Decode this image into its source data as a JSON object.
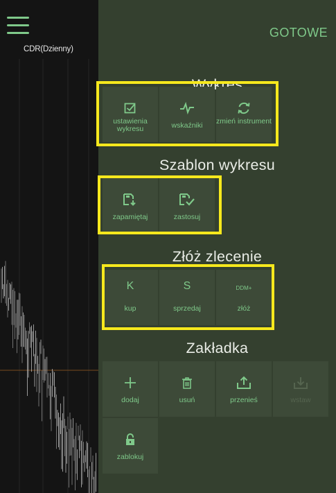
{
  "chart_strip": {
    "symbol_label": "CDR(Dzienny)"
  },
  "panel": {
    "done_label": "GOTOWE",
    "sections": [
      {
        "title": "Wykres",
        "items": [
          {
            "label": "ustawienia wykresu",
            "icon": "checkbox-edit-icon",
            "enabled": true
          },
          {
            "label": "wskaźniki",
            "icon": "pulse-line-icon",
            "enabled": true
          },
          {
            "label": "zmień instrument",
            "icon": "refresh-cycle-icon",
            "enabled": true
          }
        ]
      },
      {
        "title": "Szablon wykresu",
        "items": [
          {
            "label": "zapamiętaj",
            "icon": "save-floppy-icon",
            "enabled": true
          },
          {
            "label": "zastosuj",
            "icon": "apply-floppy-icon",
            "enabled": true
          }
        ]
      },
      {
        "title": "Złóż zlecenie",
        "items": [
          {
            "label": "kup",
            "symbol": "K",
            "enabled": true
          },
          {
            "label": "sprzedaj",
            "symbol": "S",
            "enabled": true
          },
          {
            "label": "złóż",
            "symbol": "DDM+",
            "enabled": true
          }
        ]
      },
      {
        "title": "Zakładka",
        "items": [
          {
            "label": "dodaj",
            "icon": "plus-icon",
            "enabled": true
          },
          {
            "label": "usuń",
            "icon": "trash-icon",
            "enabled": true
          },
          {
            "label": "przenieś",
            "icon": "upload-tray-icon",
            "enabled": true
          },
          {
            "label": "wstaw",
            "icon": "download-tray-icon",
            "enabled": false
          },
          {
            "label": "zablokuj",
            "icon": "padlock-icon",
            "enabled": true
          }
        ]
      }
    ]
  },
  "colors": {
    "panel_bg": "#34402f",
    "tile_bg": "#3d4a38",
    "accent_green": "#7fc98a",
    "highlight_yellow": "#f6e81d",
    "chart_bg": "#141414"
  }
}
